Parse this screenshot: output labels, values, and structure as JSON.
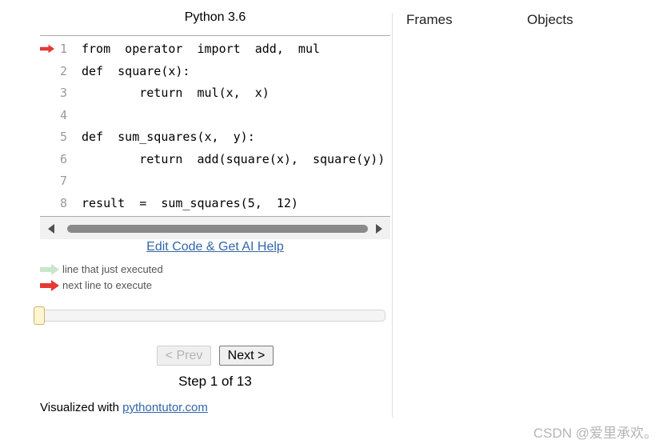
{
  "language_title": "Python 3.6",
  "code_lines": [
    {
      "num": "1",
      "text": "from  operator  import  add,  mul",
      "marker": "next"
    },
    {
      "num": "2",
      "text": "def  square(x):",
      "marker": ""
    },
    {
      "num": "3",
      "text": "        return  mul(x,  x)",
      "marker": ""
    },
    {
      "num": "4",
      "text": "",
      "marker": ""
    },
    {
      "num": "5",
      "text": "def  sum_squares(x,  y):",
      "marker": ""
    },
    {
      "num": "6",
      "text": "        return  add(square(x),  square(y))",
      "marker": ""
    },
    {
      "num": "7",
      "text": "",
      "marker": ""
    },
    {
      "num": "8",
      "text": "result  =  sum_squares(5,  12)",
      "marker": ""
    }
  ],
  "edit_link": "Edit Code & Get AI Help",
  "legend": {
    "executed_label": "line that just executed",
    "next_label": "next line to execute",
    "executed_color": "#c8e6c9",
    "next_color": "#e53935"
  },
  "slider": {
    "position": 0.0
  },
  "buttons": {
    "prev": "< Prev",
    "next": "Next >"
  },
  "step_text": "Step 1 of 13",
  "footer": {
    "prefix": "Visualized with ",
    "link": "pythontutor.com"
  },
  "right_panel": {
    "frames_header": "Frames",
    "objects_header": "Objects"
  },
  "watermark": "CSDN @爱里承欢。"
}
